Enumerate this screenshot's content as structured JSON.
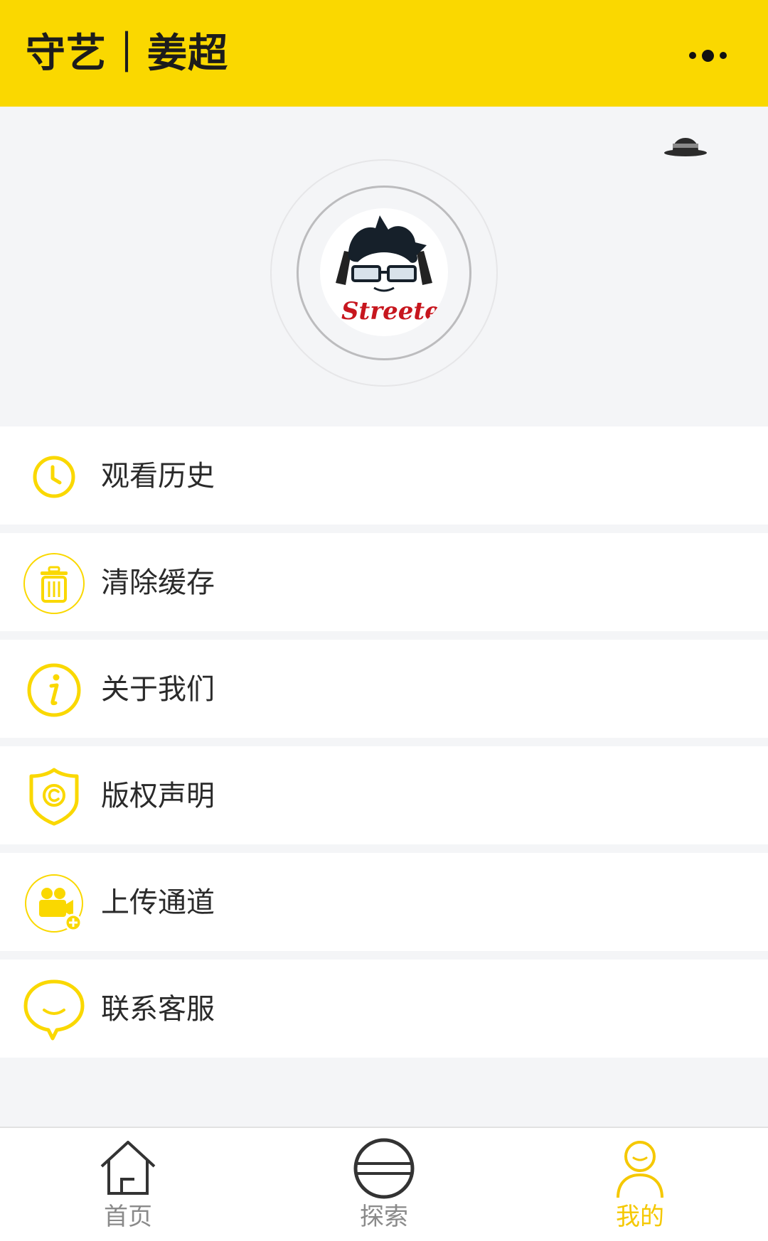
{
  "header": {
    "title": "守艺｜姜超",
    "accent_color": "#fad800",
    "more_icon": "more-dots-icon"
  },
  "profile": {
    "hat_icon": "bowler-hat-icon",
    "avatar_logo_text": "Streeter"
  },
  "menu": {
    "items": [
      {
        "label": "观看历史",
        "icon": "clock-icon"
      },
      {
        "label": "清除缓存",
        "icon": "trash-icon"
      },
      {
        "label": "关于我们",
        "icon": "info-icon"
      },
      {
        "label": "版权声明",
        "icon": "copyright-shield-icon"
      },
      {
        "label": "上传通道",
        "icon": "video-upload-icon"
      },
      {
        "label": "联系客服",
        "icon": "chat-bubble-icon"
      }
    ]
  },
  "tabbar": {
    "tabs": [
      {
        "label": "首页",
        "icon": "home-icon",
        "active": false
      },
      {
        "label": "探索",
        "icon": "explore-icon",
        "active": false
      },
      {
        "label": "我的",
        "icon": "user-icon",
        "active": true
      }
    ],
    "active_color": "#f5c800",
    "inactive_color": "#8a8a8a"
  }
}
